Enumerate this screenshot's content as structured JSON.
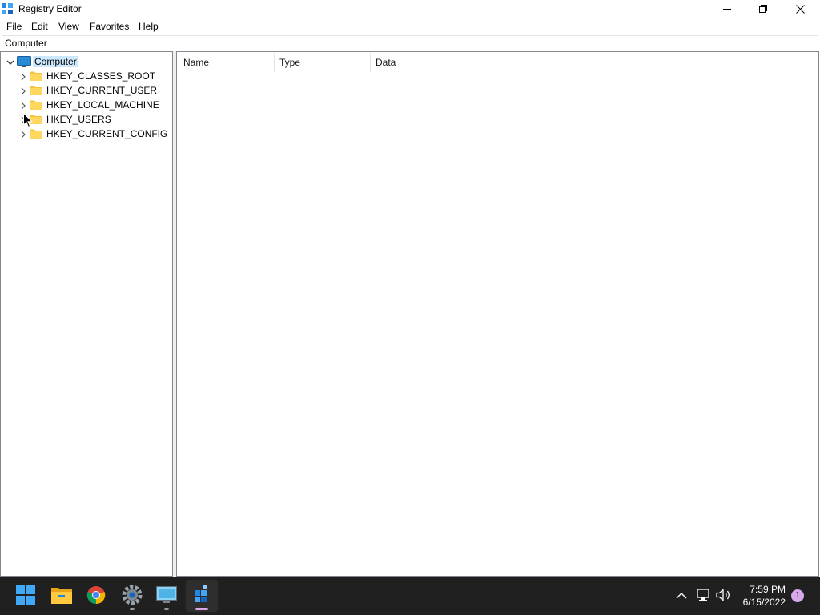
{
  "window": {
    "title": "Registry Editor"
  },
  "menu": [
    "File",
    "Edit",
    "View",
    "Favorites",
    "Help"
  ],
  "address": "Computer",
  "tree": {
    "root": "Computer",
    "children": [
      "HKEY_CLASSES_ROOT",
      "HKEY_CURRENT_USER",
      "HKEY_LOCAL_MACHINE",
      "HKEY_USERS",
      "HKEY_CURRENT_CONFIG"
    ]
  },
  "columns": [
    "Name",
    "Type",
    "Data"
  ],
  "taskbar": {
    "apps": [
      "start-icon",
      "file-explorer-icon",
      "chrome-icon",
      "settings-icon",
      "remote-desktop-icon",
      "registry-editor-icon"
    ],
    "tray": [
      "chevron-up-icon",
      "network-icon",
      "volume-icon"
    ],
    "time": "7:59 PM",
    "date": "6/15/2022",
    "notification_count": "1"
  },
  "colors": {
    "selection": "#cce8ff",
    "taskbar": "#202020",
    "folder": "#f5c542"
  }
}
